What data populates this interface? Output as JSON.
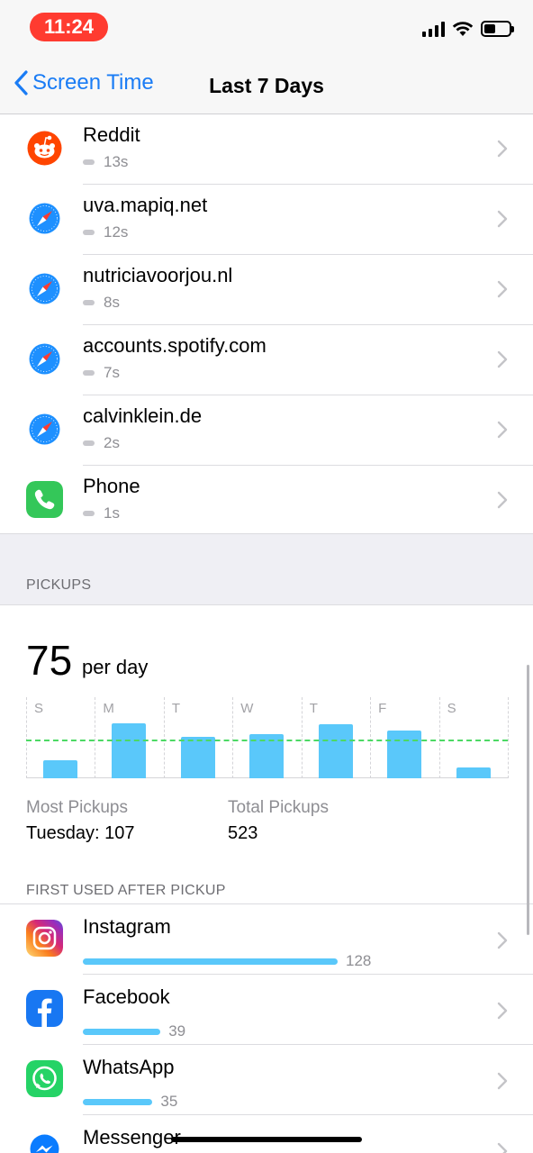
{
  "status": {
    "time": "11:24",
    "battery_level": 0.45
  },
  "nav": {
    "back_label": "Screen Time",
    "title": "Last 7 Days"
  },
  "apps": [
    {
      "name": "Reddit",
      "time": "13s",
      "icon": "reddit-icon"
    },
    {
      "name": "uva.mapiq.net",
      "time": "12s",
      "icon": "safari-icon"
    },
    {
      "name": "nutriciavoorjou.nl",
      "time": "8s",
      "icon": "safari-icon"
    },
    {
      "name": "accounts.spotify.com",
      "time": "7s",
      "icon": "safari-icon"
    },
    {
      "name": "calvinklein.de",
      "time": "2s",
      "icon": "safari-icon"
    },
    {
      "name": "Phone",
      "time": "1s",
      "icon": "phone-icon"
    }
  ],
  "pickups": {
    "header": "PICKUPS",
    "value": "75",
    "unit": "per day",
    "most_label": "Most Pickups",
    "most_value": "Tuesday: 107",
    "total_label": "Total Pickups",
    "total_value": "523"
  },
  "chart_data": {
    "type": "bar",
    "categories": [
      "S",
      "M",
      "T",
      "W",
      "T",
      "F",
      "S"
    ],
    "values": [
      22,
      68,
      51,
      54,
      67,
      59,
      13
    ],
    "average": 48,
    "ylim": [
      0,
      100
    ]
  },
  "first_used": {
    "header": "FIRST USED AFTER PICKUP",
    "max": 128,
    "items": [
      {
        "name": "Instagram",
        "count": 128,
        "count_label": "128",
        "icon": "instagram-icon"
      },
      {
        "name": "Facebook",
        "count": 39,
        "count_label": "39",
        "icon": "facebook-icon"
      },
      {
        "name": "WhatsApp",
        "count": 35,
        "count_label": "35",
        "icon": "whatsapp-icon"
      },
      {
        "name": "Messenger",
        "count": null,
        "count_label": "",
        "icon": "messenger-icon"
      }
    ]
  },
  "colors": {
    "accent": "#1a7cf5",
    "bar": "#5ac8fa",
    "avg_line": "#4cd964",
    "time_pill": "#ff3b30"
  }
}
